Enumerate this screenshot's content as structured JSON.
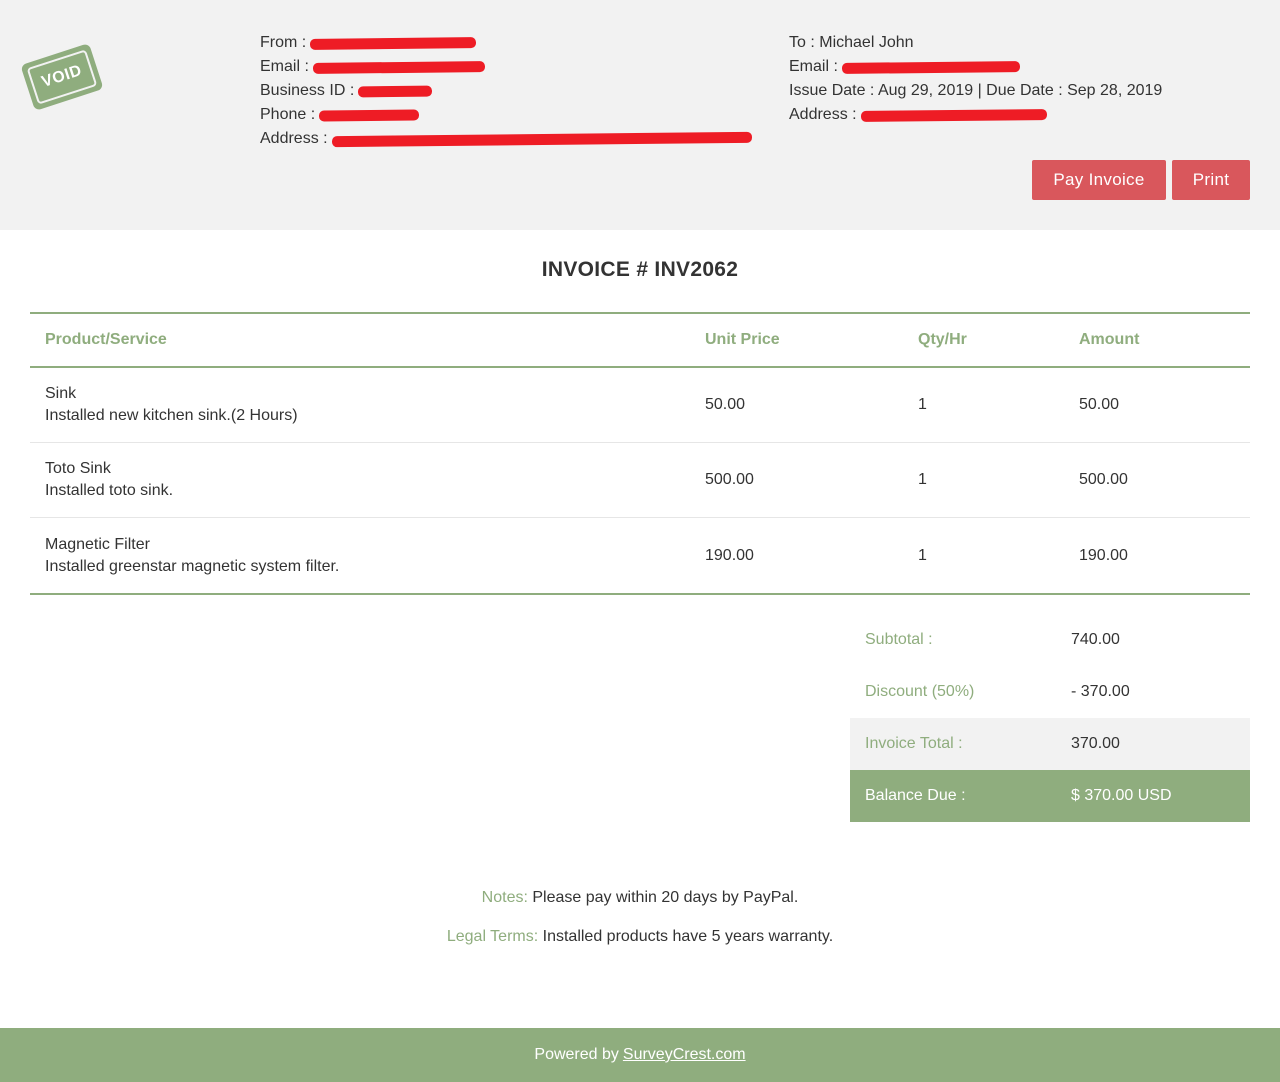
{
  "stamp": {
    "label": "VOID"
  },
  "from": {
    "from_label": "From :",
    "email_label": "Email :",
    "business_id_label": "Business ID :",
    "phone_label": "Phone :",
    "address_label": "Address :"
  },
  "to": {
    "to_line": "To : Michael John",
    "email_label": "Email :",
    "dates_line": "Issue Date : Aug 29, 2019 | Due Date : Sep 28, 2019",
    "address_label": "Address :"
  },
  "actions": {
    "pay_label": "Pay Invoice",
    "print_label": "Print"
  },
  "invoice": {
    "title": "INVOICE # INV2062"
  },
  "table": {
    "headers": [
      "Product/Service",
      "Unit Price",
      "Qty/Hr",
      "Amount"
    ],
    "rows": [
      {
        "name": "Sink",
        "desc": "Installed new kitchen sink.(2 Hours)",
        "price": "50.00",
        "qty": "1",
        "amount": "50.00"
      },
      {
        "name": "Toto Sink",
        "desc": "Installed toto sink.",
        "price": "500.00",
        "qty": "1",
        "amount": "500.00"
      },
      {
        "name": "Magnetic Filter",
        "desc": "Installed greenstar magnetic system filter.",
        "price": "190.00",
        "qty": "1",
        "amount": "190.00"
      }
    ]
  },
  "totals": {
    "subtotal_label": "Subtotal :",
    "subtotal": "740.00",
    "discount_label": "Discount (50%)",
    "discount": "- 370.00",
    "total_label": "Invoice Total :",
    "total": "370.00",
    "due_label": "Balance Due :",
    "due": "$ 370.00 USD"
  },
  "notes": {
    "notes_label": "Notes:",
    "notes_text": "Please pay within 20 days by PayPal.",
    "terms_label": "Legal Terms:",
    "terms_text": "Installed products have 5 years warranty."
  },
  "footer": {
    "powered_label": "Powered by",
    "link_text": "SurveyCrest.com"
  },
  "colors": {
    "accent": "#8fad7e",
    "button": "#d9575c",
    "redaction": "#ee1c25",
    "header_bg": "#f2f2f2"
  }
}
